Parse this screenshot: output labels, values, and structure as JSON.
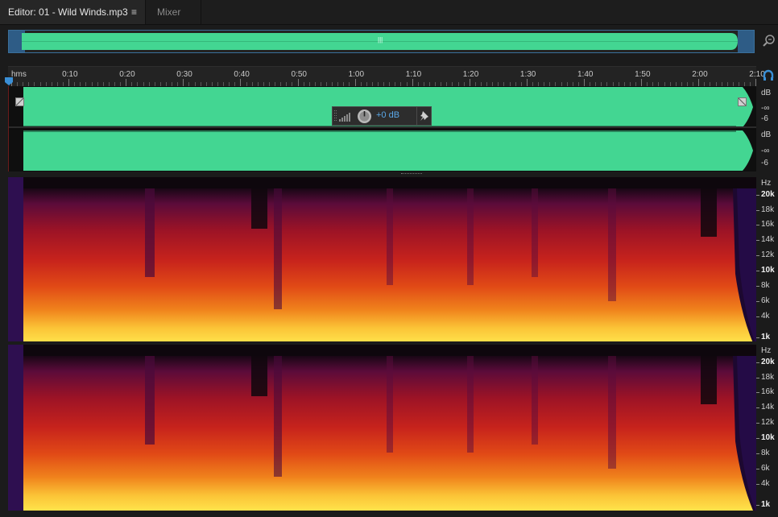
{
  "tabs": {
    "editor_label": "Editor: 01 - Wild Winds.mp3",
    "editor_menu_icon": "≡",
    "mixer_label": "Mixer"
  },
  "overview": {
    "center_marker": "|||"
  },
  "ruler": {
    "labels": [
      "hms",
      "0:10",
      "0:20",
      "0:30",
      "0:40",
      "0:50",
      "1:00",
      "1:10",
      "1:20",
      "1:30",
      "1:40",
      "1:50",
      "2:00",
      "2:10"
    ]
  },
  "waveform": {
    "db_labels_left": [
      "dB",
      "-∞",
      "-6"
    ],
    "db_labels_right": [
      "dB",
      "-∞",
      "-6"
    ]
  },
  "hud": {
    "volume_value": "+0 dB"
  },
  "spectral": {
    "hz_labels_left": [
      "Hz",
      "20k",
      "18k",
      "16k",
      "14k",
      "12k",
      "10k",
      "8k",
      "6k",
      "4k",
      "1k"
    ],
    "hz_labels_right": [
      "Hz",
      "20k",
      "18k",
      "16k",
      "14k",
      "12k",
      "10k",
      "8k",
      "6k",
      "4k",
      "1k"
    ]
  },
  "colors": {
    "waveform": "#43d692",
    "accent": "#3a8fd6",
    "background": "#1b1b1b"
  },
  "icons": {
    "zoom": "zoom-magnifier-icon",
    "loop": "loop-playback-icon",
    "knob": "volume-knob-icon",
    "pin": "pin-icon",
    "meter": "level-meter-icon",
    "playhead": "playhead-marker-icon"
  }
}
